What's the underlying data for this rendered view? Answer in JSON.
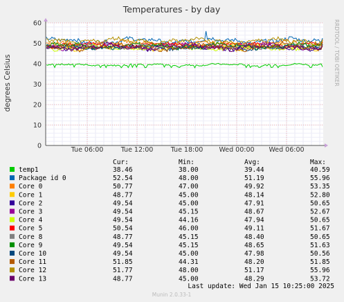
{
  "chart_data": {
    "type": "line",
    "title": "Temperatures - by day",
    "ylabel": "degrees Celsius",
    "side_label": "RRDTOOL / TOBI OETIKER",
    "ylim": [
      0,
      60
    ],
    "yticks": [
      0,
      10,
      20,
      30,
      40,
      50,
      60
    ],
    "xticks": [
      "Tue 06:00",
      "Tue 12:00",
      "Tue 18:00",
      "Wed 00:00",
      "Wed 06:00"
    ],
    "grid": true,
    "legend_placement": "bottom",
    "columns": [
      "Cur:",
      "Min:",
      "Avg:",
      "Max:"
    ],
    "series": [
      {
        "name": "temp1",
        "color": "#00cc00",
        "cur": "38.46",
        "min": "38.00",
        "avg": "39.44",
        "max": "40.59"
      },
      {
        "name": "Package id 0",
        "color": "#0066b3",
        "cur": "52.54",
        "min": "48.00",
        "avg": "51.19",
        "max": "55.96"
      },
      {
        "name": "Core 0",
        "color": "#ff8000",
        "cur": "50.77",
        "min": "47.00",
        "avg": "49.92",
        "max": "53.35"
      },
      {
        "name": "Core 1",
        "color": "#ffcc00",
        "cur": "48.77",
        "min": "45.00",
        "avg": "48.14",
        "max": "52.80"
      },
      {
        "name": "Core 2",
        "color": "#330099",
        "cur": "49.54",
        "min": "45.00",
        "avg": "47.91",
        "max": "50.65"
      },
      {
        "name": "Core 3",
        "color": "#990099",
        "cur": "49.54",
        "min": "45.15",
        "avg": "48.67",
        "max": "52.67"
      },
      {
        "name": "Core 4",
        "color": "#ccff00",
        "cur": "49.54",
        "min": "44.16",
        "avg": "47.94",
        "max": "50.65"
      },
      {
        "name": "Core 5",
        "color": "#ff0000",
        "cur": "50.54",
        "min": "46.00",
        "avg": "49.11",
        "max": "51.67"
      },
      {
        "name": "Core 8",
        "color": "#808080",
        "cur": "48.77",
        "min": "45.15",
        "avg": "48.40",
        "max": "50.65"
      },
      {
        "name": "Core 9",
        "color": "#008f00",
        "cur": "49.54",
        "min": "45.15",
        "avg": "48.65",
        "max": "51.63"
      },
      {
        "name": "Core 10",
        "color": "#00487d",
        "cur": "49.54",
        "min": "45.00",
        "avg": "47.98",
        "max": "50.56"
      },
      {
        "name": "Core 11",
        "color": "#b35a00",
        "cur": "51.85",
        "min": "44.31",
        "avg": "48.20",
        "max": "51.85"
      },
      {
        "name": "Core 12",
        "color": "#b38f00",
        "cur": "51.77",
        "min": "48.00",
        "avg": "51.17",
        "max": "55.96"
      },
      {
        "name": "Core 13",
        "color": "#6b006b",
        "cur": "48.77",
        "min": "45.00",
        "avg": "48.29",
        "max": "53.72"
      }
    ]
  },
  "footer": {
    "last_update": "Last update: Wed Jan 15 10:25:00 2025",
    "version": "Munin 2.0.33-1"
  }
}
